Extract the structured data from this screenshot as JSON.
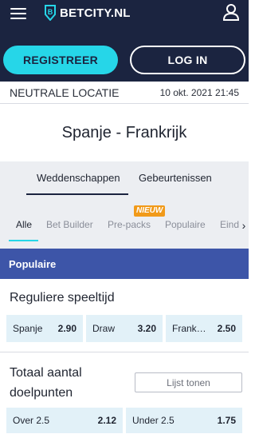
{
  "header": {
    "logo_text": "BETCITY.NL",
    "menu_icon": "hamburger-menu-icon",
    "account_icon": "account-icon"
  },
  "auth": {
    "register_label": "REGISTREER",
    "login_label": "LOG IN"
  },
  "event": {
    "venue": "NEUTRALE LOCATIE",
    "datetime": "10 okt. 2021 21:45",
    "title": "Spanje - Frankrijk"
  },
  "tabs": [
    {
      "label": "Weddenschappen",
      "active": true
    },
    {
      "label": "Gebeurtenissen",
      "active": false
    }
  ],
  "filters": {
    "items": [
      "Alle",
      "Bet Builder",
      "Pre-packs",
      "Populaire",
      "Eind"
    ],
    "active": "Alle",
    "new_badge": "NIEUW"
  },
  "section": {
    "title": "Populaire"
  },
  "market1": {
    "title": "Reguliere speeltijd",
    "odds": [
      {
        "label": "Spanje",
        "price": "2.90"
      },
      {
        "label": "Draw",
        "price": "3.20"
      },
      {
        "label": "Frank…",
        "price": "2.50"
      }
    ]
  },
  "market2": {
    "title": "Totaal aantal doelpunten",
    "list_button": "Lijst tonen",
    "odds": [
      {
        "label": "Over 2.5",
        "price": "2.12"
      },
      {
        "label": "Under 2.5",
        "price": "1.75"
      }
    ]
  },
  "colors": {
    "navy": "#1b2440",
    "cyan": "#26d6e8",
    "section_blue": "#3d55a8",
    "odds_bg": "#e2f1f8",
    "badge_orange": "#f19a1a"
  }
}
